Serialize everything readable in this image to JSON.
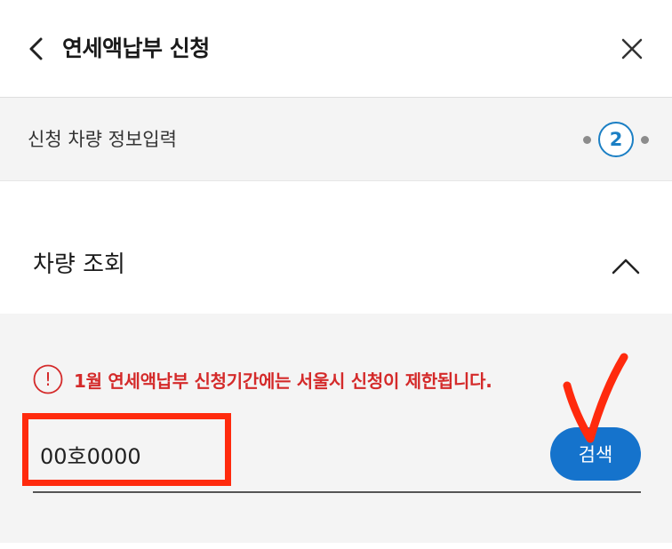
{
  "header": {
    "title": "연세액납부 신청"
  },
  "step": {
    "label": "신청 차량 정보입력",
    "current": "2"
  },
  "section": {
    "title": "차량 조회"
  },
  "notice": {
    "icon_text": "!",
    "text": "1월 연세액납부 신청기간에는 서울시 신청이 제한됩니다."
  },
  "vehicle_input": {
    "value": "00호0000"
  },
  "search_button": {
    "label": "검색"
  },
  "colors": {
    "accent": "#1573cc",
    "step_accent": "#1b7fc4",
    "notice_red": "#d42a2a",
    "annotation_red": "#ff2a0d"
  },
  "icons": [
    "back-arrow-icon",
    "close-icon",
    "chevron-up-icon",
    "exclamation-icon",
    "checkmark-annotation"
  ]
}
